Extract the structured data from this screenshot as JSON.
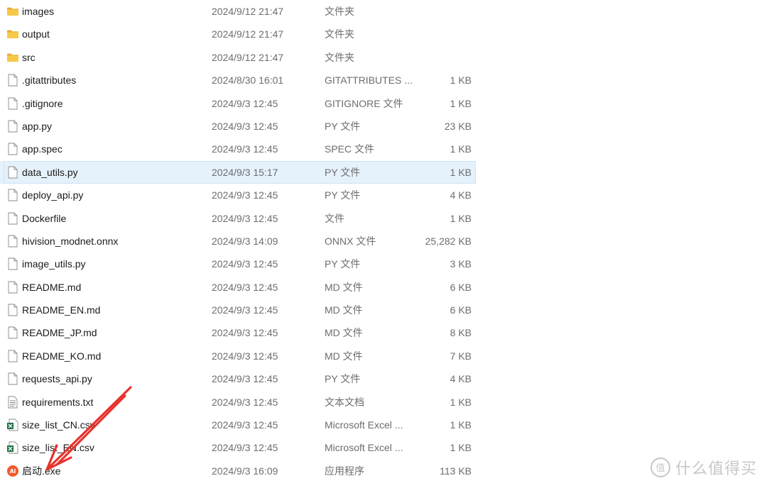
{
  "files": [
    {
      "name": "images",
      "date": "2024/9/12 21:47",
      "type": "文件夹",
      "size": "",
      "icon": "folder-icon"
    },
    {
      "name": "output",
      "date": "2024/9/12 21:47",
      "type": "文件夹",
      "size": "",
      "icon": "folder-icon"
    },
    {
      "name": "src",
      "date": "2024/9/12 21:47",
      "type": "文件夹",
      "size": "",
      "icon": "folder-icon"
    },
    {
      "name": ".gitattributes",
      "date": "2024/8/30 16:01",
      "type": "GITATTRIBUTES ...",
      "size": "1 KB",
      "icon": "file-icon"
    },
    {
      "name": ".gitignore",
      "date": "2024/9/3 12:45",
      "type": "GITIGNORE 文件",
      "size": "1 KB",
      "icon": "file-icon"
    },
    {
      "name": "app.py",
      "date": "2024/9/3 12:45",
      "type": "PY 文件",
      "size": "23 KB",
      "icon": "file-icon"
    },
    {
      "name": "app.spec",
      "date": "2024/9/3 12:45",
      "type": "SPEC 文件",
      "size": "1 KB",
      "icon": "file-icon"
    },
    {
      "name": "data_utils.py",
      "date": "2024/9/3 15:17",
      "type": "PY 文件",
      "size": "1 KB",
      "icon": "file-icon",
      "selected": true
    },
    {
      "name": "deploy_api.py",
      "date": "2024/9/3 12:45",
      "type": "PY 文件",
      "size": "4 KB",
      "icon": "file-icon"
    },
    {
      "name": "Dockerfile",
      "date": "2024/9/3 12:45",
      "type": "文件",
      "size": "1 KB",
      "icon": "file-icon"
    },
    {
      "name": "hivision_modnet.onnx",
      "date": "2024/9/3 14:09",
      "type": "ONNX 文件",
      "size": "25,282 KB",
      "icon": "file-icon"
    },
    {
      "name": "image_utils.py",
      "date": "2024/9/3 12:45",
      "type": "PY 文件",
      "size": "3 KB",
      "icon": "file-icon"
    },
    {
      "name": "README.md",
      "date": "2024/9/3 12:45",
      "type": "MD 文件",
      "size": "6 KB",
      "icon": "file-icon"
    },
    {
      "name": "README_EN.md",
      "date": "2024/9/3 12:45",
      "type": "MD 文件",
      "size": "6 KB",
      "icon": "file-icon"
    },
    {
      "name": "README_JP.md",
      "date": "2024/9/3 12:45",
      "type": "MD 文件",
      "size": "8 KB",
      "icon": "file-icon"
    },
    {
      "name": "README_KO.md",
      "date": "2024/9/3 12:45",
      "type": "MD 文件",
      "size": "7 KB",
      "icon": "file-icon"
    },
    {
      "name": "requests_api.py",
      "date": "2024/9/3 12:45",
      "type": "PY 文件",
      "size": "4 KB",
      "icon": "file-icon"
    },
    {
      "name": "requirements.txt",
      "date": "2024/9/3 12:45",
      "type": "文本文档",
      "size": "1 KB",
      "icon": "text-file-icon"
    },
    {
      "name": "size_list_CN.csv",
      "date": "2024/9/3 12:45",
      "type": "Microsoft Excel ...",
      "size": "1 KB",
      "icon": "excel-file-icon"
    },
    {
      "name": "size_list_EN.csv",
      "date": "2024/9/3 12:45",
      "type": "Microsoft Excel ...",
      "size": "1 KB",
      "icon": "excel-file-icon"
    },
    {
      "name": "启动.exe",
      "date": "2024/9/3 16:09",
      "type": "应用程序",
      "size": "113 KB",
      "icon": "app-exe-icon"
    }
  ],
  "watermark": {
    "text": "什么值得买",
    "badge": "值"
  },
  "colors": {
    "selected_row": "#e5f1fb",
    "folder": "#f0c14b",
    "arrow": "#e8322d",
    "excel": "#1d7044",
    "app_icon": "#f15a2b"
  }
}
